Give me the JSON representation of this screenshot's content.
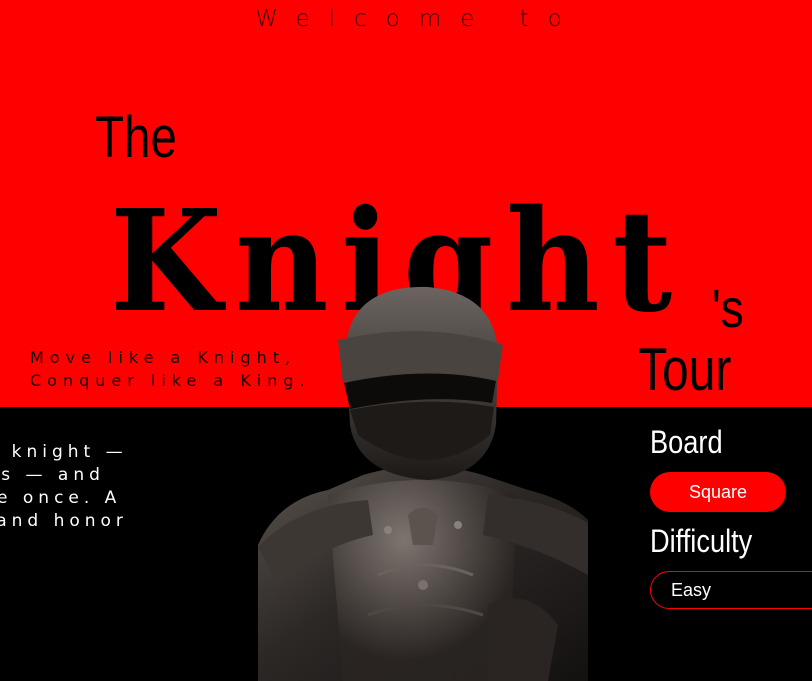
{
  "hero": {
    "welcome": "Welcome to",
    "the": "The",
    "knight": "Knight",
    "possessive": "'s",
    "tour": "Tour",
    "tagline_line1": "Move like a Knight,",
    "tagline_line2": "Conquer like a King."
  },
  "intro": {
    "line1": "ue knight —",
    "line2": "eps — and",
    "line3": "are once. A",
    "line4": "g and honor"
  },
  "controls": {
    "board_label": "Board",
    "board_value": "Square",
    "difficulty_label": "Difficulty",
    "difficulty_value": "Easy"
  },
  "colors": {
    "accent": "#ff0000",
    "background": "#000000",
    "text_light": "#ffffff"
  },
  "icons": {
    "hero_image": "knight-armor"
  }
}
